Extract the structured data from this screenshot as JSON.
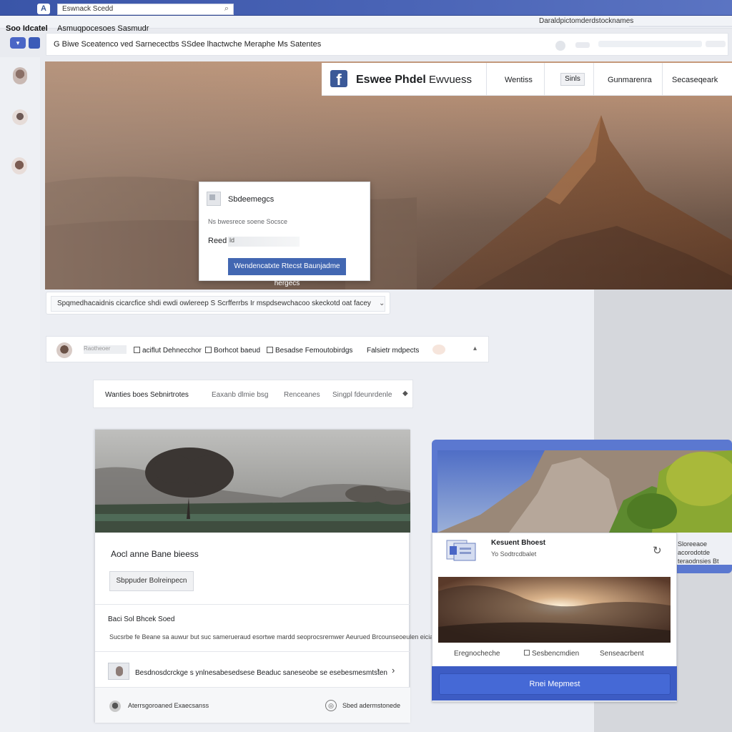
{
  "browser": {
    "logo": "A",
    "search_value": "Eswnack Scedd",
    "search_icon": "magnifier-icon"
  },
  "strip": {
    "right_text": "Daraldpictomderdstocknames"
  },
  "menu": {
    "left": "Soo Idcatel",
    "title": "Asmuqpocesoes Sasmudr"
  },
  "address": {
    "text": "G Biwe Sceatenco ved Sarnecectbs SSdee lhactwche Meraphe Ms Satentes"
  },
  "hero": {
    "brand_logo": "f",
    "brand_name": "Eswee Phdel",
    "brand_suffix": "Ewvuess",
    "nav": [
      "Wentiss",
      "Sinls",
      "Gunmarenra",
      "Secaseqeark"
    ],
    "dialog": {
      "title": "Sbdeemegcs",
      "subtitle": "Ns bwesrece soene Socsce",
      "field_label": "Reed",
      "field_value": "ld",
      "button": "Wendencatxte Rtecst Baunjadme hergecs"
    }
  },
  "composer": {
    "text": "Spqmedhacaidnis cicarcfice shdi ewdi owlereep S Scrfferrbs Ir mspdsewchacoo skeckotd oat facey",
    "arrow": "chevron-down-icon"
  },
  "action_bar": {
    "blur": "Raotheoer",
    "items": [
      "aciflut Dehnecchor",
      "Borhcot baeud",
      "Besadse Femoutobirdgs",
      "Falsietr mdpects"
    ]
  },
  "tabs": [
    "Wanties boes Sebnirtrotes",
    "Eaxanb dlmie bsg",
    "Renceanes",
    "Singpl fdeunrdenle"
  ],
  "post": {
    "title": "Aocl anne Bane bieess",
    "button": "Sbppuder Bolreinpecn",
    "subheading": "Baci Sol Bhcek Soed",
    "description": "Sucsrbe fe Beane sa auwur but suc samerueraud esortwe mardd seoprocsremwer Aeurued Brcounseoeulen eiciaes mtaurnet",
    "row_text": "Besdnosdcrckge s ynlnesabesedsese Beaduc saneseobe se esebesmesmtsten",
    "footer_text": "Aterrsgoroaned Exaecsanss",
    "footer_text2": "Sbed adermstonede"
  },
  "right_card": {
    "title": "Kesuent Bhoest",
    "subtitle": "Yo Sodtrcdbalet",
    "back_text": "Sloreeaoe\nacorodotde\nteraodnsies Bt",
    "links": [
      "Eregnocheche",
      "Sesbencmdien",
      "Senseacrbent"
    ],
    "button": "Rnei Mepmest"
  },
  "colors": {
    "accent": "#4267b2",
    "topbar": "#3a55a8",
    "facebook_blue": "#3b5998"
  }
}
